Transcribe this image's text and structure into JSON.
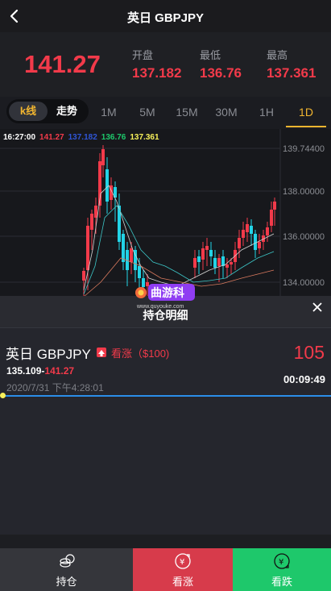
{
  "nav": {
    "title": "英日 GBPJPY"
  },
  "quote": {
    "price": "141.27",
    "open_label": "开盘",
    "open": "137.182",
    "low_label": "最低",
    "low": "136.76",
    "high_label": "最高",
    "high": "137.361"
  },
  "tabs": {
    "kline": "k线",
    "trend": "走势",
    "periods": [
      "1M",
      "5M",
      "15M",
      "30M",
      "1H",
      "1D"
    ],
    "active_period": "1D"
  },
  "chart": {
    "ohlc": {
      "time": "16:27:00",
      "close": "141.27",
      "open": "137.182",
      "low": "136.76",
      "high": "137.361"
    },
    "y_ticks": [
      "139.74400",
      "138.00000",
      "136.00000",
      "134.00000"
    ]
  },
  "watermark": {
    "text": "曲游科",
    "url": "www.quyouke.com"
  },
  "sheet": {
    "title": "持仓明细",
    "position": {
      "name": "英日 GBPJPY",
      "direction": "看涨（$100)",
      "pl": "105",
      "entry": "135.109",
      "current": "141.27",
      "time": "2020/7/31 下午4:28:01",
      "countdown": "00:09:49",
      "progress": 0.0
    }
  },
  "tabbar": {
    "hold": "持仓",
    "up": "看涨",
    "down": "看跌"
  },
  "colors": {
    "red": "#f23a4a",
    "green": "#1ec86b",
    "gold": "#f1b530",
    "blue": "#2b8ee8",
    "cyan": "#22d3e6"
  }
}
